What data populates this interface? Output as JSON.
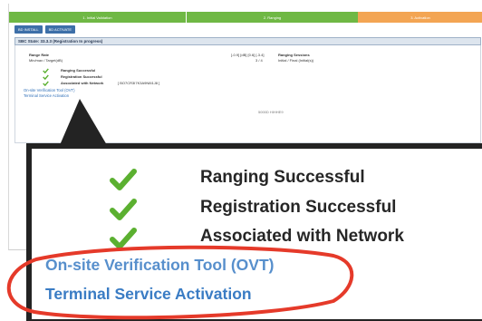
{
  "progress": {
    "steps": [
      "1. Initial Validation",
      "2. Ranging",
      "3. Activation"
    ]
  },
  "toolbar": {
    "buttons": [
      "BD INSTALL",
      "BD ACTIVATE"
    ]
  },
  "status": {
    "text": "SBC State: 33.3.3 (Registration In progress)"
  },
  "panel": {
    "range_rate_label": "Range Rate",
    "range_rate_sub": "Min/max / Target(dB)",
    "mid_value_1": "[-0.9] [dB] [0.6] [-3.4]",
    "mid_value_2": "3 / 4",
    "ranging_sessions_label": "Ranging Sessions",
    "ranging_sessions_sub": "Initial / Final (Initial(s))",
    "checks": [
      "Ranging Successful",
      "Registration Successful",
      "Associated with Network"
    ],
    "network_id": "[ BO7CR3I7K3A9N8I1J8 ]",
    "links": [
      "On-site Verification Tool (OVT)",
      "Terminal Service Activation"
    ],
    "footer_text": "5000D HIHHE9"
  },
  "zoom": {
    "checks": [
      "Ranging Successful",
      "Registration Successful",
      "Associated with Network"
    ],
    "links": [
      "On-site Verification Tool (OVT)",
      "Terminal Service Activation"
    ]
  },
  "colors": {
    "green": "#5bb030",
    "link_blue": "#3a7cc4",
    "highlight_red": "#e53a2a",
    "frame": "#232323"
  }
}
